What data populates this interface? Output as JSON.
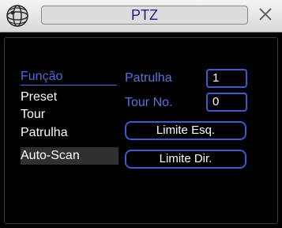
{
  "window": {
    "title": "PTZ"
  },
  "menu": {
    "header": "Função",
    "items": [
      {
        "label": "Preset"
      },
      {
        "label": "Tour"
      },
      {
        "label": "Patrulha"
      },
      {
        "label": "Auto-Scan",
        "selected": true
      }
    ]
  },
  "form": {
    "patrulha_label": "Patrulha",
    "patrulha_value": "1",
    "tour_label": "Tour No.",
    "tour_value": "0",
    "limit_left_label": "Limite Esq.",
    "limit_right_label": "Limite Dir."
  },
  "colors": {
    "accent": "#3d5ad0",
    "label": "#5a73e0",
    "text": "#ffffff",
    "background": "#000000"
  },
  "icons": {
    "app": "camera-globe-icon",
    "close": "close-icon"
  }
}
